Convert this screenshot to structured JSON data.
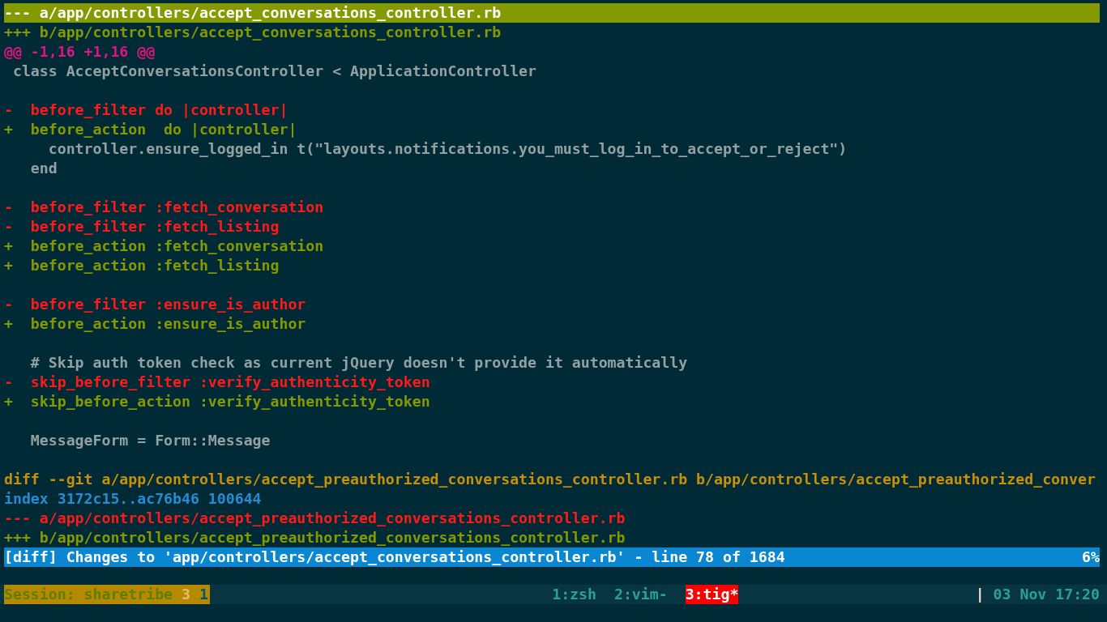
{
  "diff_lines": [
    {
      "kind": "old_file",
      "text": "--- a/app/controllers/accept_conversations_controller.rb",
      "selected": true
    },
    {
      "kind": "new_file",
      "text": "+++ b/app/controllers/accept_conversations_controller.rb",
      "selected": false
    },
    {
      "kind": "hunk",
      "text": "@@ -1,16 +1,16 @@",
      "selected": false
    },
    {
      "kind": "context",
      "text": " class AcceptConversationsController < ApplicationController",
      "selected": false
    },
    {
      "kind": "blank"
    },
    {
      "kind": "del",
      "text": "-  before_filter do |controller|",
      "selected": false
    },
    {
      "kind": "add",
      "text": "+  before_action  do |controller|",
      "selected": false
    },
    {
      "kind": "context",
      "text": "     controller.ensure_logged_in t(\"layouts.notifications.you_must_log_in_to_accept_or_reject\")",
      "selected": false
    },
    {
      "kind": "context",
      "text": "   end",
      "selected": false
    },
    {
      "kind": "blank"
    },
    {
      "kind": "del",
      "text": "-  before_filter :fetch_conversation",
      "selected": false
    },
    {
      "kind": "del",
      "text": "-  before_filter :fetch_listing",
      "selected": false
    },
    {
      "kind": "add",
      "text": "+  before_action :fetch_conversation",
      "selected": false
    },
    {
      "kind": "add",
      "text": "+  before_action :fetch_listing",
      "selected": false
    },
    {
      "kind": "blank"
    },
    {
      "kind": "del",
      "text": "-  before_filter :ensure_is_author",
      "selected": false
    },
    {
      "kind": "add",
      "text": "+  before_action :ensure_is_author",
      "selected": false
    },
    {
      "kind": "blank"
    },
    {
      "kind": "context",
      "text": "   # Skip auth token check as current jQuery doesn't provide it automatically",
      "selected": false
    },
    {
      "kind": "del",
      "text": "-  skip_before_filter :verify_authenticity_token",
      "selected": false
    },
    {
      "kind": "add",
      "text": "+  skip_before_action :verify_authenticity_token",
      "selected": false
    },
    {
      "kind": "blank"
    },
    {
      "kind": "context",
      "text": "   MessageForm = Form::Message",
      "selected": false
    },
    {
      "kind": "blank"
    },
    {
      "kind": "diff",
      "text": "diff --git a/app/controllers/accept_preauthorized_conversations_controller.rb b/app/controllers/accept_preauthorized_conver",
      "selected": false
    },
    {
      "kind": "index",
      "text": "index 3172c15..ac76b46 100644",
      "selected": false
    },
    {
      "kind": "del_file",
      "text": "--- a/app/controllers/accept_preauthorized_conversations_controller.rb",
      "selected": false
    },
    {
      "kind": "new_file",
      "text": "+++ b/app/controllers/accept_preauthorized_conversations_controller.rb",
      "selected": false
    }
  ],
  "status_bar": {
    "text": "[diff] Changes to 'app/controllers/accept_conversations_controller.rb' - line 78 of 1684",
    "percent": "6%"
  },
  "tmux_bar": {
    "session": "Session: sharetribe",
    "session_window": "3",
    "session_pane": "1",
    "windows": [
      {
        "label": "1:zsh",
        "selected": false
      },
      {
        "label": "2:vim-",
        "selected": false
      },
      {
        "label": "3:tig*",
        "selected": true
      }
    ],
    "separator": "|",
    "clock": "03 Nov 17:20"
  }
}
